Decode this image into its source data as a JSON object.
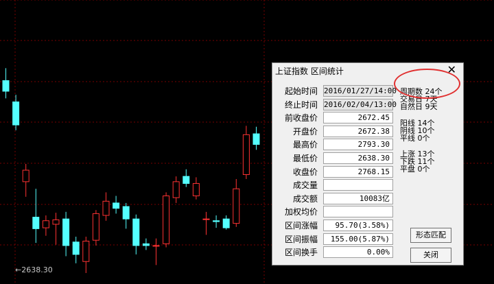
{
  "chart_data": {
    "type": "candlestick",
    "low_marker_label": "←2638.30",
    "colors": {
      "up": "#ff3232",
      "down": "#54ffff",
      "grid": "#7a0000",
      "background": "#000000"
    },
    "candles": [
      {
        "o": 2846,
        "h": 2860,
        "l": 2826,
        "c": 2834
      },
      {
        "o": 2822,
        "h": 2830,
        "l": 2790,
        "c": 2796
      },
      {
        "o": 2732,
        "h": 2752,
        "l": 2715,
        "c": 2745
      },
      {
        "o": 2692,
        "h": 2724,
        "l": 2663,
        "c": 2679
      },
      {
        "o": 2680,
        "h": 2694,
        "l": 2671,
        "c": 2688
      },
      {
        "o": 2684,
        "h": 2697,
        "l": 2661,
        "c": 2689
      },
      {
        "o": 2690,
        "h": 2698,
        "l": 2648,
        "c": 2660
      },
      {
        "o": 2664,
        "h": 2670,
        "l": 2640,
        "c": 2650
      },
      {
        "o": 2642,
        "h": 2670,
        "l": 2629,
        "c": 2665
      },
      {
        "o": 2666,
        "h": 2700,
        "l": 2660,
        "c": 2696
      },
      {
        "o": 2694,
        "h": 2720,
        "l": 2688,
        "c": 2710
      },
      {
        "o": 2708,
        "h": 2716,
        "l": 2696,
        "c": 2702
      },
      {
        "o": 2704,
        "h": 2708,
        "l": 2679,
        "c": 2690
      },
      {
        "o": 2690,
        "h": 2695,
        "l": 2650,
        "c": 2660
      },
      {
        "o": 2662,
        "h": 2668,
        "l": 2655,
        "c": 2660
      },
      {
        "o": 2660,
        "h": 2668,
        "l": 2638,
        "c": 2660
      },
      {
        "o": 2662,
        "h": 2720,
        "l": 2658,
        "c": 2716
      },
      {
        "o": 2714,
        "h": 2738,
        "l": 2708,
        "c": 2732
      },
      {
        "o": 2738,
        "h": 2746,
        "l": 2726,
        "c": 2730
      },
      {
        "o": 2716,
        "h": 2737,
        "l": 2712,
        "c": 2730
      },
      {
        "o": 2690,
        "h": 2698,
        "l": 2672,
        "c": 2690
      },
      {
        "o": 2688,
        "h": 2694,
        "l": 2680,
        "c": 2687
      },
      {
        "o": 2690,
        "h": 2694,
        "l": 2678,
        "c": 2680
      },
      {
        "o": 2685,
        "h": 2735,
        "l": 2681,
        "c": 2724
      },
      {
        "o": 2740,
        "h": 2795,
        "l": 2735,
        "c": 2785
      },
      {
        "o": 2786,
        "h": 2794,
        "l": 2768,
        "c": 2774
      }
    ]
  },
  "dialog": {
    "title": "上证指数 区间统计",
    "close_glyph": "✕",
    "fields": [
      {
        "label": "起始时间",
        "value": "2016/01/27/14:00",
        "grey": true
      },
      {
        "label": "终止时间",
        "value": "2016/02/04/13:00",
        "grey": true
      },
      {
        "label": "前收盘价",
        "value": "2672.45"
      },
      {
        "label": "开盘价",
        "value": "2672.38"
      },
      {
        "label": "最高价",
        "value": "2793.30"
      },
      {
        "label": "最低价",
        "value": "2638.30"
      },
      {
        "label": "收盘价",
        "value": "2768.15"
      },
      {
        "label": "成交量",
        "value": ""
      },
      {
        "label": "成交额",
        "value": "10083亿"
      },
      {
        "label": "加权均价",
        "value": ""
      },
      {
        "label": "区间涨幅",
        "value": "95.70(3.58%)"
      },
      {
        "label": "区间振幅",
        "value": "155.00(5.87%)"
      },
      {
        "label": "区间换手",
        "value": "0.00%"
      }
    ],
    "stats": {
      "period_count": "周期数 24个",
      "trading_days": "交易日 7天",
      "natural_days": "自然日 9天",
      "yang_lines": "阳线 14个",
      "yin_lines": "阴线 10个",
      "flat_lines": "平线 0个",
      "rise": "上涨 13个",
      "fall": "下跌 11个",
      "flat": "平盘 0个"
    },
    "pattern_button": "形态匹配",
    "close_button": "关闭"
  }
}
